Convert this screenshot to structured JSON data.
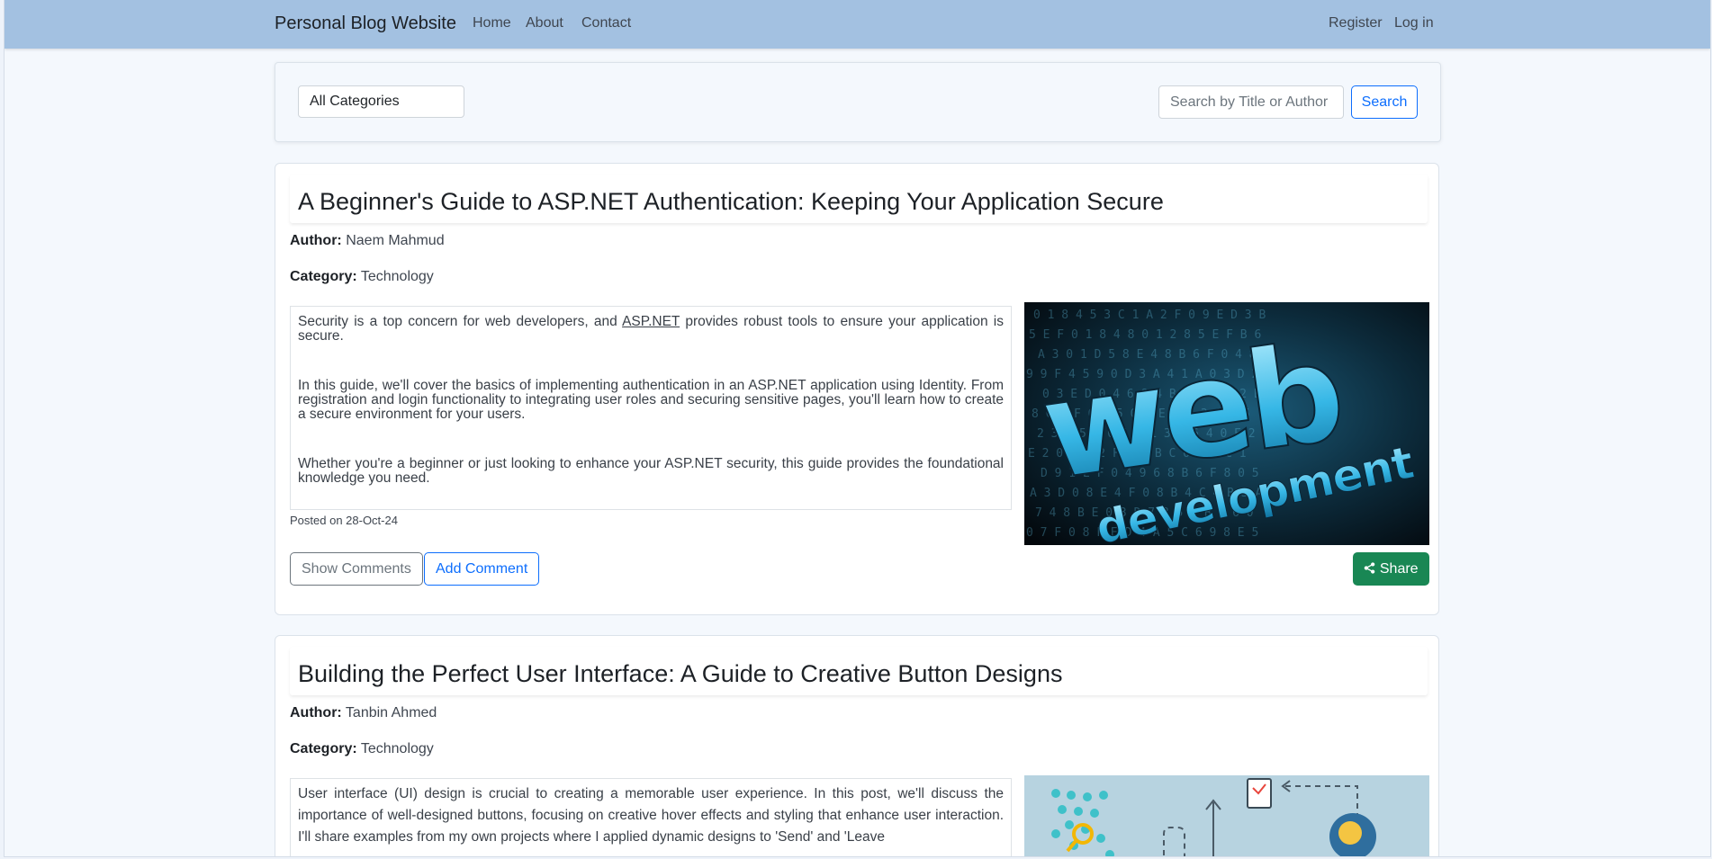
{
  "navbar": {
    "brand": "Personal Blog Website",
    "links": [
      "Home",
      "About",
      "Contact"
    ],
    "right_links": [
      "Register",
      "Log in"
    ],
    "background": "#a3c1e1"
  },
  "filter": {
    "category_selected": "All Categories",
    "search_placeholder": "Search by Title or Author",
    "search_button": "Search"
  },
  "posts": [
    {
      "title": "A Beginner's Guide to ASP.NET Authentication: Keeping Your Application Secure",
      "author_label": "Author:",
      "author": "Naem Mahmud",
      "category_label": "Category:",
      "category": "Technology",
      "paragraph1_before": "Security is a top concern for web developers, and ",
      "paragraph1_link": "ASP.NET",
      "paragraph1_after": " provides robust tools to ensure your application is secure.",
      "paragraph2": "In this guide, we'll cover the basics of implementing authentication in an ASP.NET application using Identity. From registration and login functionality to integrating user roles and securing sensitive pages, you'll learn how to create a secure environment for your users.",
      "paragraph3": "Whether you're a beginner or just looking to enhance your ASP.NET security, this guide provides the foundational knowledge you need.",
      "posted": "Posted on 28-Oct-24",
      "image_text_1": "web",
      "image_text_2": "development",
      "show_comments": "Show Comments",
      "add_comment": "Add Comment",
      "share": "Share"
    },
    {
      "title": "Building the Perfect User Interface: A Guide to Creative Button Designs",
      "author_label": "Author:",
      "author": "Tanbin Ahmed",
      "category_label": "Category:",
      "category": "Technology",
      "paragraph1": "User interface (UI) design is crucial to creating a memorable user experience. In this post, we'll discuss the importance of well-designed buttons, focusing on creative hover effects and styling that enhance user interaction. I'll share examples from my own projects where I applied dynamic designs to 'Send' and 'Leave"
    }
  ],
  "colors": {
    "primary": "#0d6efd",
    "success": "#198754",
    "secondary": "#6c757d"
  }
}
